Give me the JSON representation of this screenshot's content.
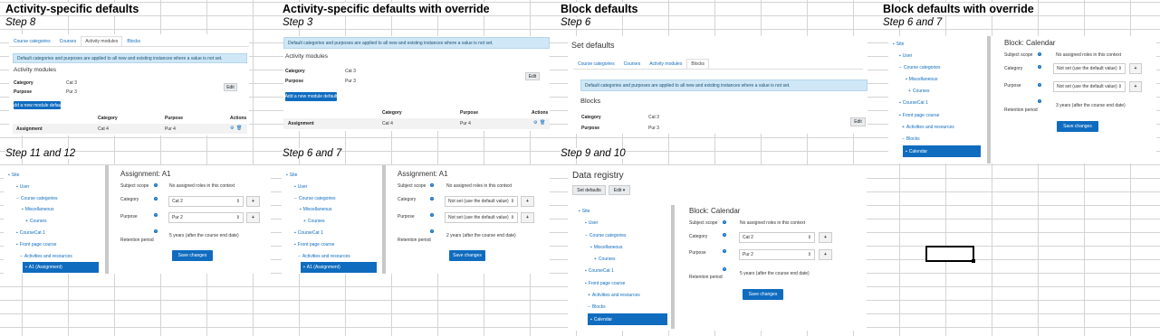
{
  "headings": {
    "h1": "Activity-specific defaults",
    "h2": "Activity-specific defaults with override",
    "h3": "Block defaults",
    "h4": "Block defaults with override"
  },
  "steps": {
    "s1": "Step 8",
    "s2": "Step 3",
    "s3": "Step 6",
    "s4": "Step 6 and 7",
    "s5": "Step 11 and 12",
    "s6": "Step 6 and 7",
    "s7": "Step 9 and 10"
  },
  "tabs": {
    "course_categories": "Course categories",
    "courses": "Courses",
    "activity_modules": "Activity modules",
    "blocks": "Blocks"
  },
  "notice": "Default categories and purposes are applied to all new and existing instances where a value is not set.",
  "shot1": {
    "section": "Activity modules",
    "category_label": "Category",
    "category_value": "Cat 3",
    "purpose_label": "Purpose",
    "purpose_value": "Pur 3",
    "edit": "Edit",
    "add_button": "Add a new module default",
    "col_category": "Category",
    "col_purpose": "Purpose",
    "col_actions": "Actions",
    "row_name": "Assignment",
    "row_category": "Cat 4",
    "row_purpose": "Pur 4"
  },
  "shot2": {
    "section": "Activity modules",
    "category_label": "Category",
    "category_value": "Cat 3",
    "purpose_label": "Purpose",
    "purpose_value": "Pur 3",
    "edit": "Edit",
    "add_button": "Add a new module default",
    "col_category": "Category",
    "col_purpose": "Purpose",
    "col_actions": "Actions",
    "row_name": "Assignment",
    "row_category": "Cat 4",
    "row_purpose": "Pur 4"
  },
  "shot3": {
    "title": "Set defaults",
    "section": "Blocks",
    "category_label": "Category",
    "category_value": "Cat 3",
    "purpose_label": "Purpose",
    "purpose_value": "Pur 3",
    "edit": "Edit"
  },
  "tree": {
    "site": "Site",
    "user": "User",
    "course_categories": "Course categories",
    "miscellaneous": "Miscellaneous",
    "courses": "Courses",
    "coursecat1": "CourseCat 1",
    "front_page_course": "Front page course",
    "activities": "Activities and resources",
    "blocks": "Blocks",
    "calendar": "Calendar",
    "assignment": "A1 (Assignment)"
  },
  "form_labels": {
    "subject_scope": "Subject scope",
    "category": "Category",
    "purpose": "Purpose",
    "retention": "Retention period",
    "no_roles": "No assigned roles in this context",
    "save": "Save changes"
  },
  "shot4": {
    "title": "Block: Calendar",
    "category_select": "Not set (use the default value)",
    "purpose_select": "Not set (use the default value)",
    "retention_value": "3 years (after the course end date)"
  },
  "shot5": {
    "title": "Assignment: A1",
    "category_select": "Cat 2",
    "purpose_select": "Pur 2",
    "retention_value": "5 years (after the course end date)"
  },
  "shot6": {
    "title": "Assignment: A1",
    "category_select": "Not set (use the default value)",
    "purpose_select": "Not set (use the default value)",
    "retention_value": "2 years (after the course end date)"
  },
  "shot7": {
    "page_title": "Data registry",
    "set_defaults": "Set defaults",
    "edit_menu": "Edit",
    "title": "Block: Calendar",
    "category_select": "Cat 2",
    "purpose_select": "Pur 2",
    "retention_value": "5 years (after the course end date)"
  },
  "colors": {
    "link": "#0f6cbf",
    "notice_bg": "#cfe7f6",
    "grid": "#d4d4d4"
  }
}
